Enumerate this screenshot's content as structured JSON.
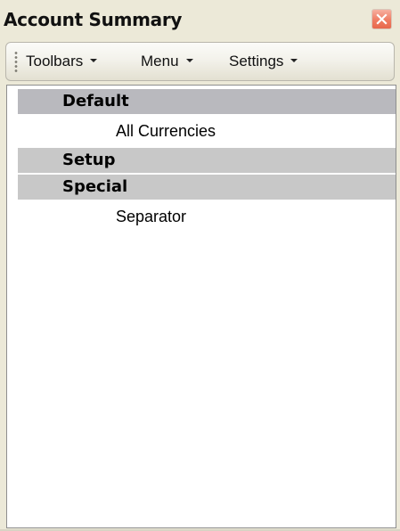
{
  "window": {
    "title": "Account Summary",
    "close_icon": "close-icon",
    "close_color": "#ef7c63"
  },
  "toolbar": {
    "items": [
      {
        "label": "Toolbars",
        "icon": "chevron-down-icon"
      },
      {
        "label": "Menu",
        "icon": "chevron-down-icon"
      },
      {
        "label": "Settings",
        "icon": "chevron-down-icon"
      }
    ]
  },
  "list": {
    "rows": [
      {
        "type": "group",
        "label": "Default",
        "selected": true
      },
      {
        "type": "item",
        "label": "All Currencies"
      },
      {
        "type": "group",
        "label": "Setup"
      },
      {
        "type": "group",
        "label": "Special"
      },
      {
        "type": "item",
        "label": "Separator"
      }
    ]
  }
}
